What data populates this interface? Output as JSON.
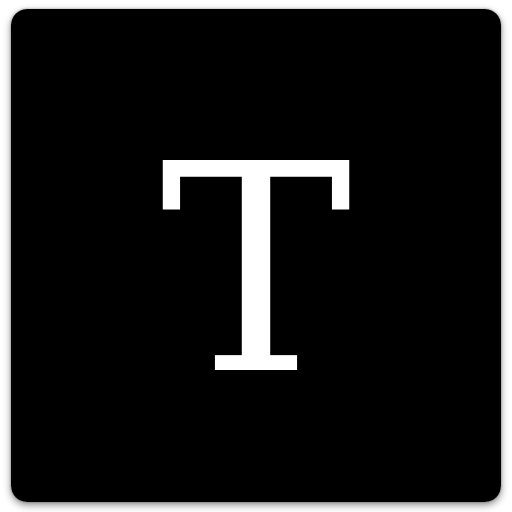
{
  "icon": {
    "name": "text-icon",
    "letter": "T",
    "background_color": "#000000",
    "letter_color": "#ffffff"
  }
}
